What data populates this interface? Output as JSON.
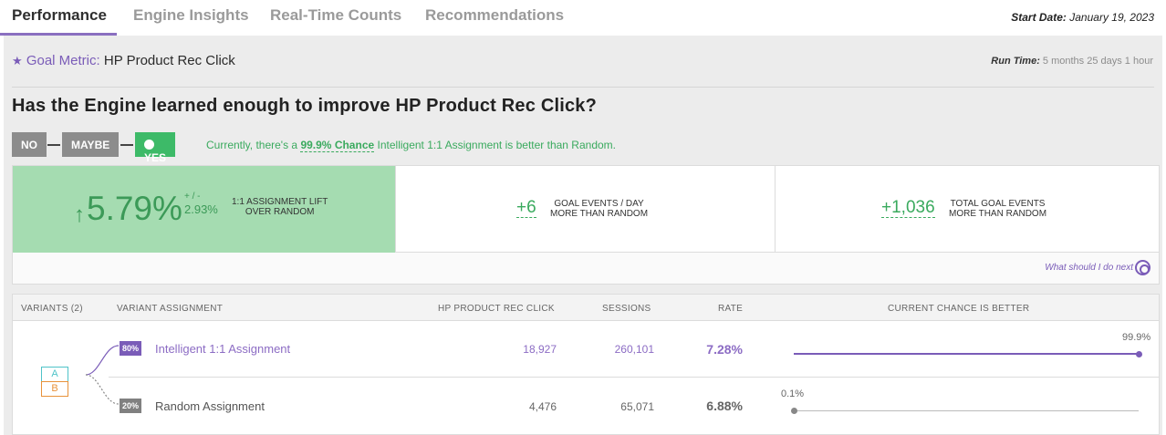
{
  "tabs": [
    {
      "label": "Performance",
      "active": true
    },
    {
      "label": "Engine Insights",
      "active": false
    },
    {
      "label": "Real-Time Counts",
      "active": false
    },
    {
      "label": "Recommendations",
      "active": false
    }
  ],
  "start_date_label": "Start Date:",
  "start_date_value": "January 19, 2023",
  "goal": {
    "label": "Goal Metric:",
    "value": "HP Product Rec Click",
    "runtime_label": "Run Time:",
    "runtime_value": "5 months 25 days 1 hour"
  },
  "question": "Has the Engine learned enough to improve HP Product Rec Click?",
  "answers": {
    "no": "NO",
    "maybe": "MAYBE",
    "yes": "YES",
    "text_prefix": "Currently, there's a ",
    "chance": "99.9% Chance",
    "text_suffix": " Intelligent 1:1 Assignment is better than Random."
  },
  "stats": {
    "lift_value": "5.79%",
    "lift_pm": "+ / -",
    "lift_margin": "2.93%",
    "lift_label_1": "1:1 ASSIGNMENT LIFT",
    "lift_label_2": "OVER RANDOM",
    "per_day_value": "+6",
    "per_day_label_1": "GOAL EVENTS / DAY",
    "per_day_label_2": "MORE THAN RANDOM",
    "total_value": "+1,036",
    "total_label_1": "TOTAL GOAL EVENTS",
    "total_label_2": "MORE THAN RANDOM"
  },
  "next_link": "What should I do next",
  "table": {
    "headers": {
      "variants": "VARIANTS (2)",
      "assignment": "VARIANT ASSIGNMENT",
      "metric": "HP PRODUCT REC CLICK",
      "sessions": "SESSIONS",
      "rate": "RATE",
      "chance": "CURRENT CHANCE IS BETTER"
    },
    "ab": {
      "a": "A",
      "b": "B"
    },
    "rows": [
      {
        "pct": "80%",
        "name": "Intelligent 1:1 Assignment",
        "metric": "18,927",
        "sessions": "260,101",
        "rate": "7.28%",
        "chance_label": "99.9%",
        "chance": 0.999
      },
      {
        "pct": "20%",
        "name": "Random Assignment",
        "metric": "4,476",
        "sessions": "65,071",
        "rate": "6.88%",
        "chance_label": "0.1%",
        "chance": 0.001
      }
    ]
  },
  "colors": {
    "accent": "#7a5cb8",
    "positive": "#3aaa5e",
    "lift_bg": "#a5dcb1",
    "variant_a": "#4fc3c8",
    "variant_b": "#e8923a"
  }
}
